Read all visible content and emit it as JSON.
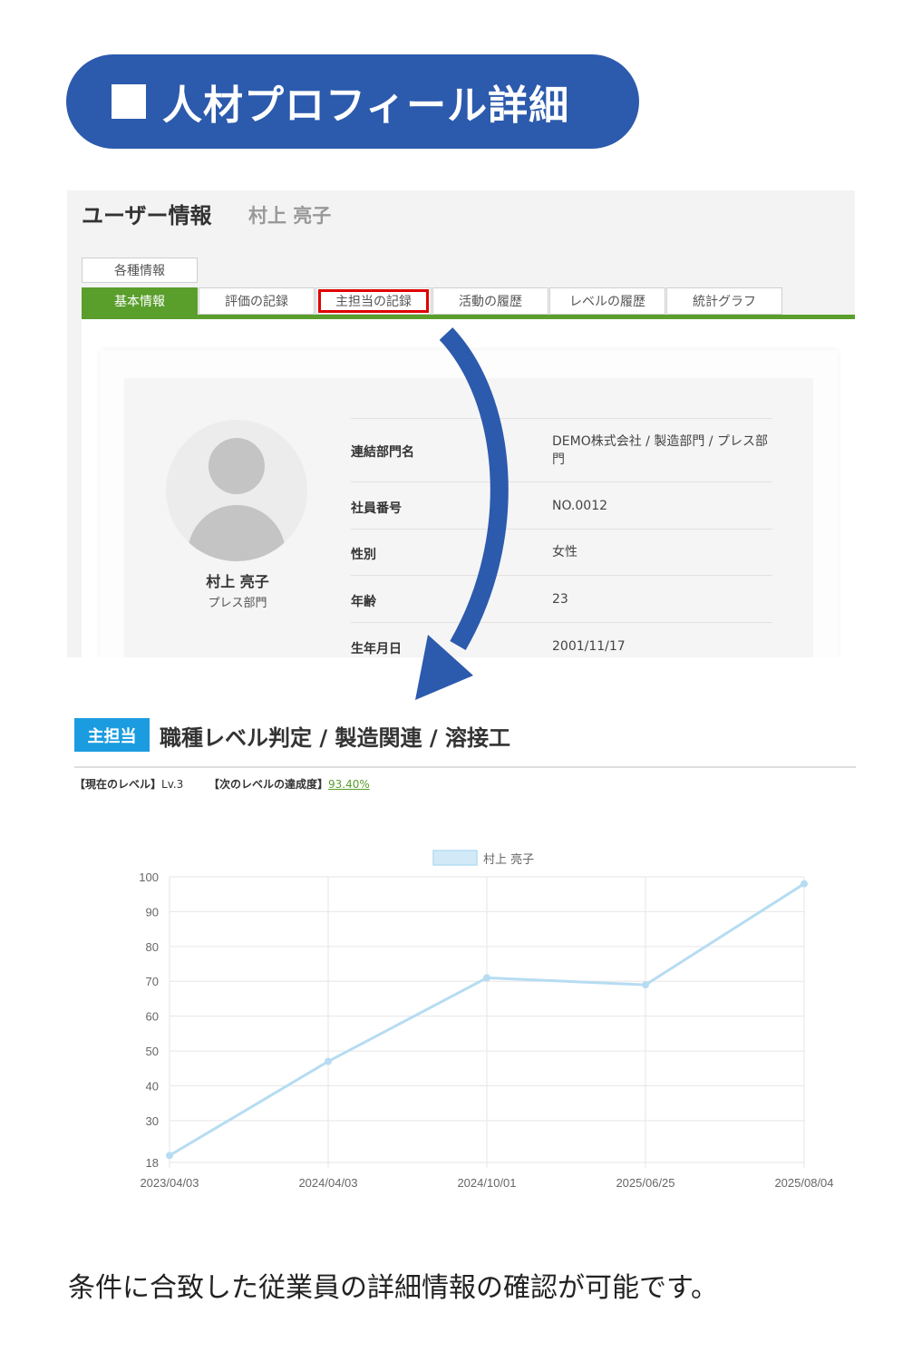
{
  "header": {
    "title": "人材プロフィール詳細"
  },
  "panel": {
    "title": "ユーザー情報",
    "user_name": "村上 亮子",
    "top_tab": "各種情報",
    "tabs": [
      {
        "label": "基本情報"
      },
      {
        "label": "評価の記録"
      },
      {
        "label": "主担当の記録"
      },
      {
        "label": "活動の履歴"
      },
      {
        "label": "レベルの履歴"
      },
      {
        "label": "統計グラフ"
      }
    ],
    "profile": {
      "name": "村上 亮子",
      "dept": "プレス部門"
    },
    "rows": [
      {
        "label": "連結部門名",
        "value": "DEMO株式会社 / 製造部門 / プレス部門"
      },
      {
        "label": "社員番号",
        "value": "NO.0012"
      },
      {
        "label": "性別",
        "value": "女性"
      },
      {
        "label": "年齢",
        "value": "23"
      },
      {
        "label": "生年月日",
        "value": "2001/11/17"
      }
    ]
  },
  "section": {
    "badge": "主担当",
    "title": "職種レベル判定 / 製造関連 / 溶接工",
    "current_level_label": "【現在のレベル】",
    "current_level_value": "Lv.3",
    "next_level_label": "【次のレベルの達成度】",
    "next_level_value": "93.40%"
  },
  "chart_data": {
    "type": "line",
    "categories": [
      "2023/04/03",
      "2024/04/03",
      "2024/10/01",
      "2025/06/25",
      "2025/08/04"
    ],
    "series": [
      {
        "name": "村上 亮子",
        "values": [
          20,
          47,
          71,
          69,
          98
        ]
      }
    ],
    "ylim": [
      18,
      100
    ],
    "yticks": [
      18,
      30,
      40,
      50,
      60,
      70,
      80,
      90,
      100
    ],
    "legend": "top",
    "grid": true,
    "color": "#b6dcf2"
  },
  "caption": "条件に合致した従業員の詳細情報の確認が可能です。"
}
